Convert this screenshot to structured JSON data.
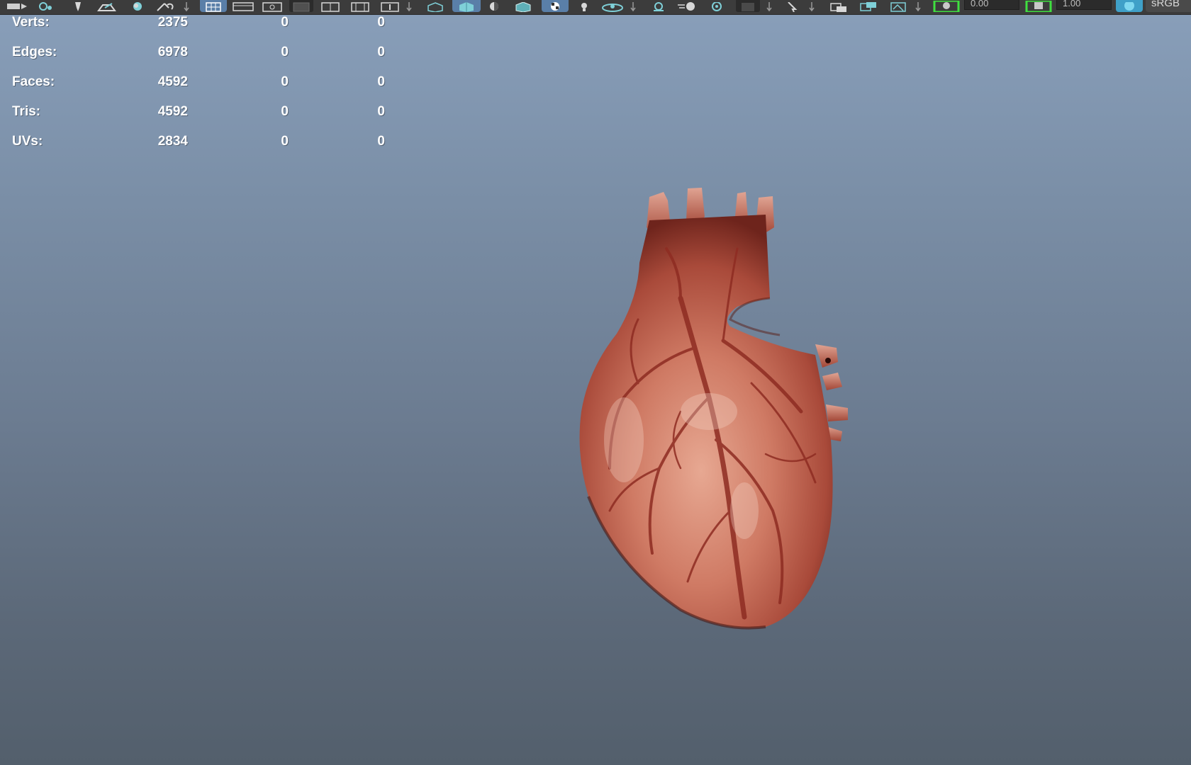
{
  "toolbar": {
    "field_1_value": "0.00",
    "field_2_value": "1.00",
    "workspace_label": "sRGB",
    "icons": [
      "move-tool-icon",
      "soft-select-icon",
      "pin-icon",
      "paint-select-icon",
      "sculpt-icon",
      "lasso-icon",
      "grid-icon",
      "film-gate-icon",
      "resolution-gate-icon",
      "gate-mask-icon",
      "field-chart-icon",
      "safe-action-icon",
      "safe-title-icon",
      "wireframe-icon",
      "smooth-shade-icon",
      "lighting-icon",
      "wireframe-on-shaded-icon",
      "textured-icon",
      "use-lights-icon",
      "shadows-icon",
      "ambient-occlusion-icon",
      "motion-blur-icon",
      "isolate-select-icon",
      "xray-icon",
      "xray-joints-icon",
      "camera-attributes-icon",
      "bookmark-icon",
      "image-plane-icon",
      "exposure-icon",
      "gamma-icon",
      "color-management-icon"
    ]
  },
  "hud": {
    "rows": [
      {
        "label": "Verts:",
        "c1": "2375",
        "c2": "0",
        "c3": "0"
      },
      {
        "label": "Edges:",
        "c1": "6978",
        "c2": "0",
        "c3": "0"
      },
      {
        "label": "Faces:",
        "c1": "4592",
        "c2": "0",
        "c3": "0"
      },
      {
        "label": "Tris:",
        "c1": "4592",
        "c2": "0",
        "c3": "0"
      },
      {
        "label": "UVs:",
        "c1": "2834",
        "c2": "0",
        "c3": "0"
      }
    ]
  },
  "viewport": {
    "background_top": "#889eb9",
    "background_bottom": "#535f6c",
    "model": "heart-model"
  }
}
